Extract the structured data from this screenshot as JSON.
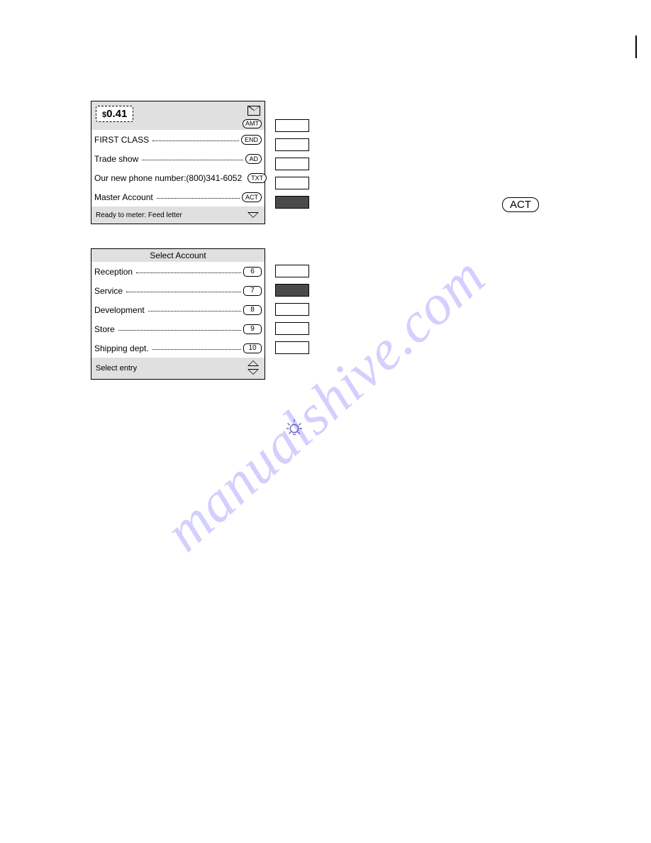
{
  "screen1": {
    "amount_currency": "$",
    "amount_value": "0.41",
    "amt_label": "AMT",
    "rows": [
      {
        "label": "FIRST CLASS",
        "pill": "END"
      },
      {
        "label": "Trade show",
        "pill": "AD"
      },
      {
        "label": "Our new phone number:(800)341-6052",
        "pill": "TXT"
      },
      {
        "label": "Master Account",
        "pill": "ACT"
      }
    ],
    "footer": "Ready to meter: Feed letter"
  },
  "softkeys1": [
    {
      "filled": false
    },
    {
      "filled": false
    },
    {
      "filled": false
    },
    {
      "filled": false
    },
    {
      "filled": true
    }
  ],
  "big_act": "ACT",
  "screen2": {
    "title": "Select Account",
    "rows": [
      {
        "label": "Reception",
        "num": "6"
      },
      {
        "label": "Service",
        "num": "7"
      },
      {
        "label": "Development",
        "num": "8"
      },
      {
        "label": "Store",
        "num": "9"
      },
      {
        "label": "Shipping dept.",
        "num": "10"
      }
    ],
    "footer": "Select entry"
  },
  "softkeys2": [
    {
      "filled": false
    },
    {
      "filled": true
    },
    {
      "filled": false
    },
    {
      "filled": false
    },
    {
      "filled": false
    }
  ],
  "watermark": "manualshive.com"
}
